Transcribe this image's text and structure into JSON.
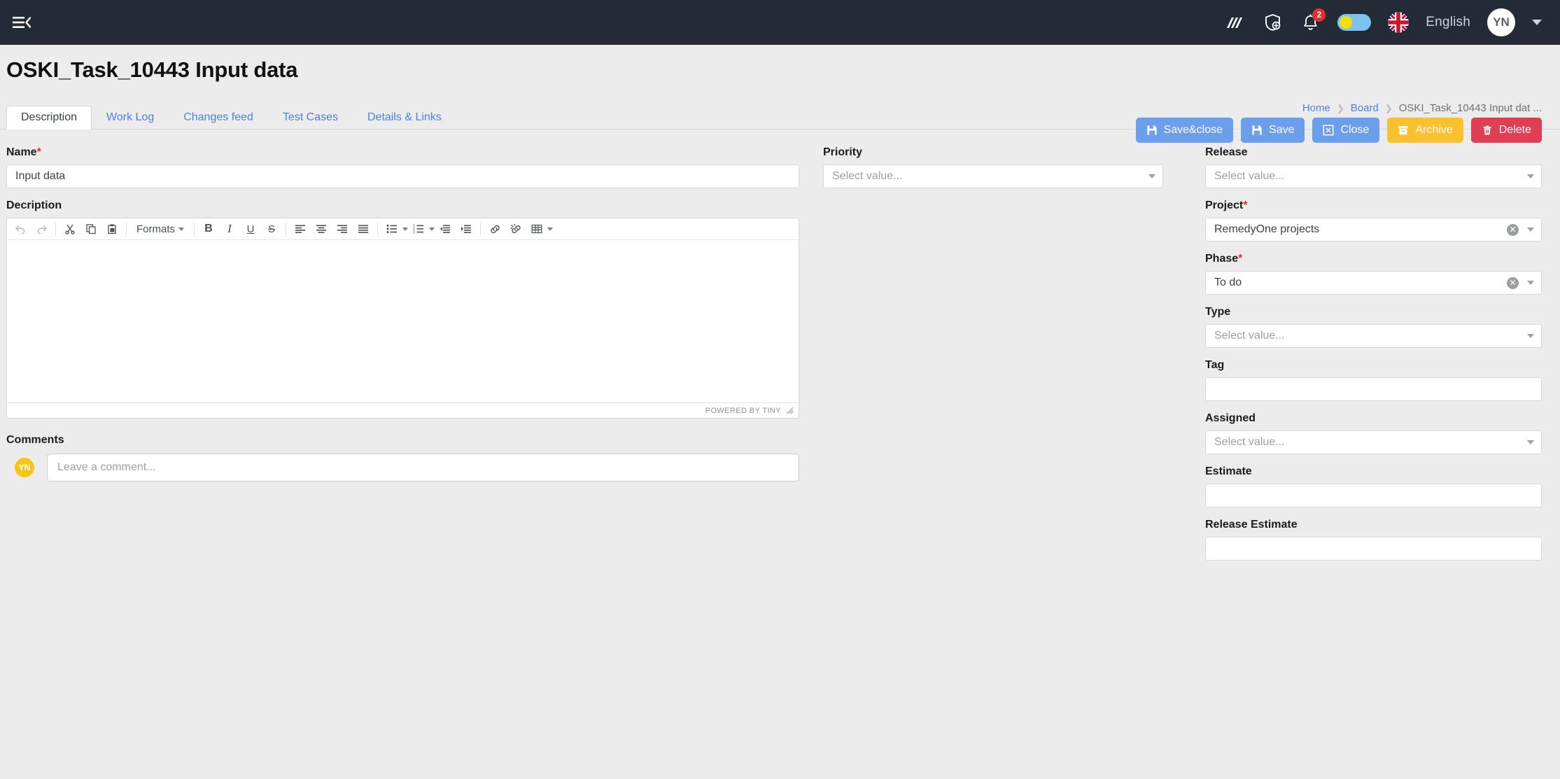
{
  "topbar": {
    "menu_icon": "hamburger-collapse-icon",
    "icons": [
      {
        "name": "analytics-icon",
        "label": ""
      },
      {
        "name": "shield-plus-icon",
        "label": ""
      }
    ],
    "notifications": {
      "icon": "bell-icon",
      "count": "2"
    },
    "theme_toggle": {
      "name": "theme-toggle",
      "state": "off"
    },
    "language": {
      "flag": "uk-flag-icon",
      "label": "English"
    },
    "user": {
      "initials": "YN",
      "caret": "chevron-down-icon"
    }
  },
  "header": {
    "title": "OSKI_Task_10443 Input data",
    "breadcrumb": [
      {
        "label": "Home",
        "type": "link"
      },
      {
        "label": "Board",
        "type": "link"
      },
      {
        "label": "OSKI_Task_10443 Input dat ...",
        "type": "current"
      }
    ],
    "actions": [
      {
        "label": "Save&close",
        "icon": "save-icon",
        "color": "#6d9eeb"
      },
      {
        "label": "Save",
        "icon": "save-icon",
        "color": "#6d9eeb"
      },
      {
        "label": "Close",
        "icon": "close-box-icon",
        "color": "#6d9eeb"
      },
      {
        "label": "Archive",
        "icon": "archive-icon",
        "color": "#fbc02d"
      },
      {
        "label": "Delete",
        "icon": "trash-icon",
        "color": "#e03e52"
      }
    ]
  },
  "tabs": [
    {
      "label": "Description",
      "active": true
    },
    {
      "label": "Work Log",
      "active": false
    },
    {
      "label": "Changes feed",
      "active": false
    },
    {
      "label": "Test Cases",
      "active": false
    },
    {
      "label": "Details & Links",
      "active": false
    }
  ],
  "form": {
    "name": {
      "label": "Name",
      "required": "*",
      "value": "Input data"
    },
    "priority": {
      "label": "Priority",
      "value": "",
      "placeholder": "Select value..."
    },
    "description": {
      "label": "Decription",
      "value": ""
    },
    "comments": {
      "label": "Comments",
      "placeholder": "Leave a comment...",
      "avatar": "YN"
    }
  },
  "editor": {
    "toolbar": [
      {
        "name": "undo-icon",
        "glyph": "↶",
        "disabled": true
      },
      {
        "name": "redo-icon",
        "glyph": "↷",
        "disabled": true
      },
      {
        "name": "cut-icon",
        "glyph": "✂"
      },
      {
        "name": "copy-icon",
        "glyph": "⧉"
      },
      {
        "name": "paste-icon",
        "glyph": "📋"
      },
      {
        "name": "formats-dropdown",
        "label": "Formats"
      },
      {
        "name": "bold-icon",
        "glyph": "B"
      },
      {
        "name": "italic-icon",
        "glyph": "I"
      },
      {
        "name": "underline-icon",
        "glyph": "U"
      },
      {
        "name": "strikethrough-icon",
        "glyph": "S"
      },
      {
        "name": "align-left-icon"
      },
      {
        "name": "align-center-icon"
      },
      {
        "name": "align-right-icon"
      },
      {
        "name": "align-justify-icon"
      },
      {
        "name": "bullet-list-icon"
      },
      {
        "name": "numbered-list-icon"
      },
      {
        "name": "outdent-icon"
      },
      {
        "name": "indent-icon"
      },
      {
        "name": "link-icon"
      },
      {
        "name": "unlink-icon"
      },
      {
        "name": "table-icon"
      }
    ],
    "formats_label": "Formats",
    "status_text": "POWERED BY TINY"
  },
  "sidebar": {
    "fields": [
      {
        "key": "release",
        "label": "Release",
        "required": "",
        "type": "select",
        "value": "",
        "placeholder": "Select value...",
        "clearable": false
      },
      {
        "key": "project",
        "label": "Project",
        "required": "*",
        "type": "select",
        "value": "RemedyOne projects",
        "placeholder": "",
        "clearable": true
      },
      {
        "key": "phase",
        "label": "Phase",
        "required": "*",
        "type": "select",
        "value": "To do",
        "placeholder": "",
        "clearable": true
      },
      {
        "key": "type",
        "label": "Type",
        "required": "",
        "type": "select",
        "value": "",
        "placeholder": "Select value...",
        "clearable": false
      },
      {
        "key": "tag",
        "label": "Tag",
        "required": "",
        "type": "text",
        "value": "",
        "placeholder": "",
        "clearable": false
      },
      {
        "key": "assigned",
        "label": "Assigned",
        "required": "",
        "type": "select",
        "value": "",
        "placeholder": "Select value...",
        "clearable": false
      },
      {
        "key": "estimate",
        "label": "Estimate",
        "required": "",
        "type": "text",
        "value": "",
        "placeholder": "",
        "clearable": false
      },
      {
        "key": "release_estimate",
        "label": "Release Estimate",
        "required": "",
        "type": "text",
        "value": "",
        "placeholder": "",
        "clearable": false
      }
    ]
  },
  "colors": {
    "topbar_bg": "#222b36",
    "page_bg": "#ececec",
    "primary": "#6d9eeb",
    "warning": "#fbc02d",
    "danger": "#e03e52",
    "link": "#4f7fe0",
    "required": "#e03131",
    "avatar_yellow": "#f5c518",
    "toggle_track": "#7ec2f0",
    "toggle_knob": "#f5e009"
  }
}
